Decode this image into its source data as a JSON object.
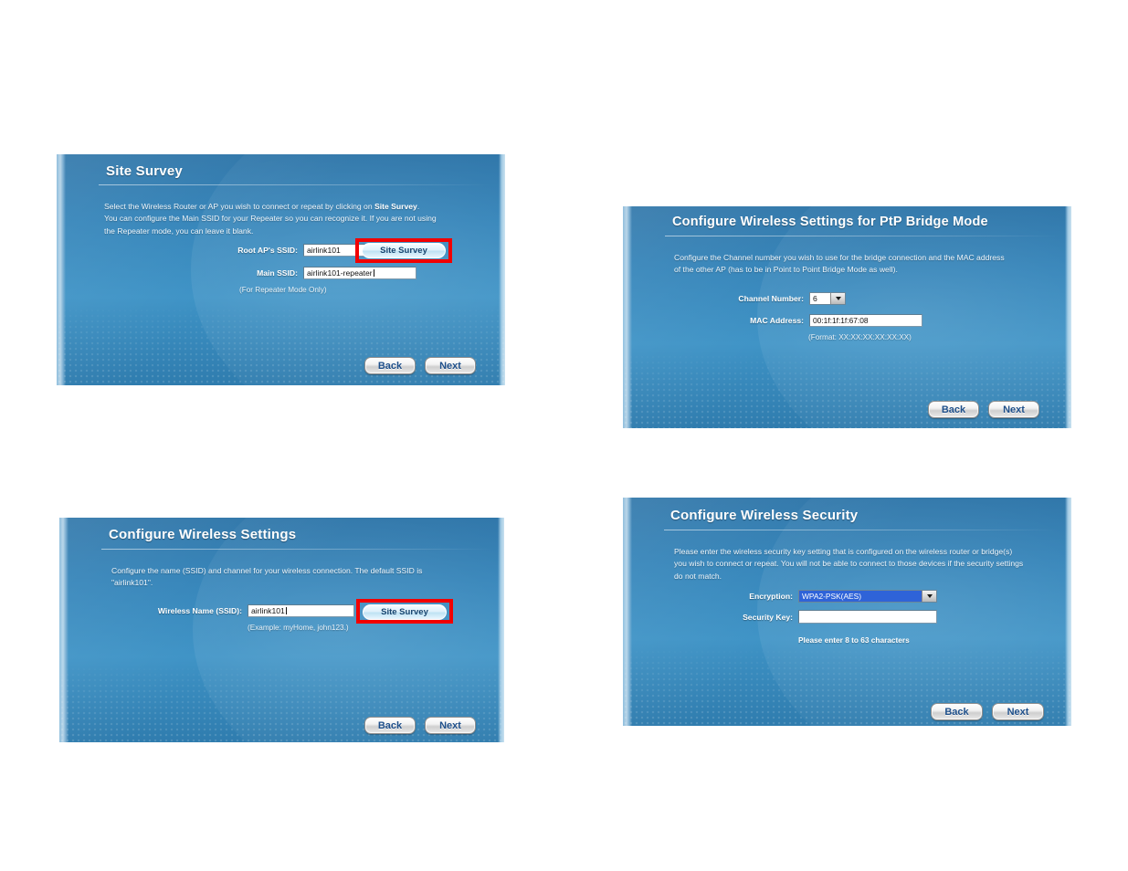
{
  "document": {
    "background_color": "#ffffff",
    "panel_gradient_top": "#2c74a8",
    "panel_gradient_bottom": "#2f7cae",
    "accent_highlight_color": "#f20000",
    "button_text_color": "#1e4f8a"
  },
  "panels": [
    {
      "id": "site-survey",
      "title": "Site Survey",
      "description_lines": [
        "Select the Wireless Router or AP you wish to connect or repeat by clicking on ",
        "You can configure the Main SSID for your Repeater so you can recognize it. If you are not using",
        "the Repeater mode, you can leave it blank."
      ],
      "description_bold_inline": "Site Survey",
      "description_line1_tail": ".",
      "fields": [
        {
          "label": "Root AP's SSID:",
          "value": "airlink101",
          "caret": false
        },
        {
          "label": "Main SSID:",
          "value": "airlink101-repeater",
          "caret": true
        }
      ],
      "hint": "(For Repeater Mode Only)",
      "site_survey_button": "Site Survey",
      "back_button": "Back",
      "next_button": "Next"
    },
    {
      "id": "ptp-bridge",
      "title": "Configure Wireless Settings for PtP Bridge Mode",
      "description_lines": [
        "Configure the Channel number you wish to use for the bridge connection and the MAC address",
        "of the other AP (has to be in Point to Point Bridge Mode as well)."
      ],
      "channel_label": "Channel Number:",
      "channel_value": "6",
      "mac_label": "MAC Address:",
      "mac_value": "00:1f:1f:1f:67:08",
      "mac_format_hint": "(Format: XX:XX:XX:XX:XX:XX)",
      "back_button": "Back",
      "next_button": "Next"
    },
    {
      "id": "wireless-settings",
      "title": "Configure Wireless Settings",
      "description_lines": [
        "Configure the name (SSID) and channel for your wireless connection. The default SSID is",
        "\"airlink101\"."
      ],
      "ssid_label": "Wireless Name (SSID):",
      "ssid_value": "airlink101",
      "ssid_example_hint": "(Example: myHome, john123.)",
      "site_survey_button": "Site Survey",
      "back_button": "Back",
      "next_button": "Next"
    },
    {
      "id": "wireless-security",
      "title": "Configure Wireless Security",
      "description_lines": [
        "Please enter the wireless security key setting that is configured on the wireless router or bridge(s)",
        "you wish to connect or repeat. You will not be able to connect to those devices if the security settings",
        "do not match."
      ],
      "encryption_label": "Encryption:",
      "encryption_value": "WPA2-PSK(AES)",
      "security_key_label": "Security Key:",
      "security_key_value": "",
      "security_key_hint": "Please enter 8 to 63 characters",
      "back_button": "Back",
      "next_button": "Next"
    }
  ]
}
